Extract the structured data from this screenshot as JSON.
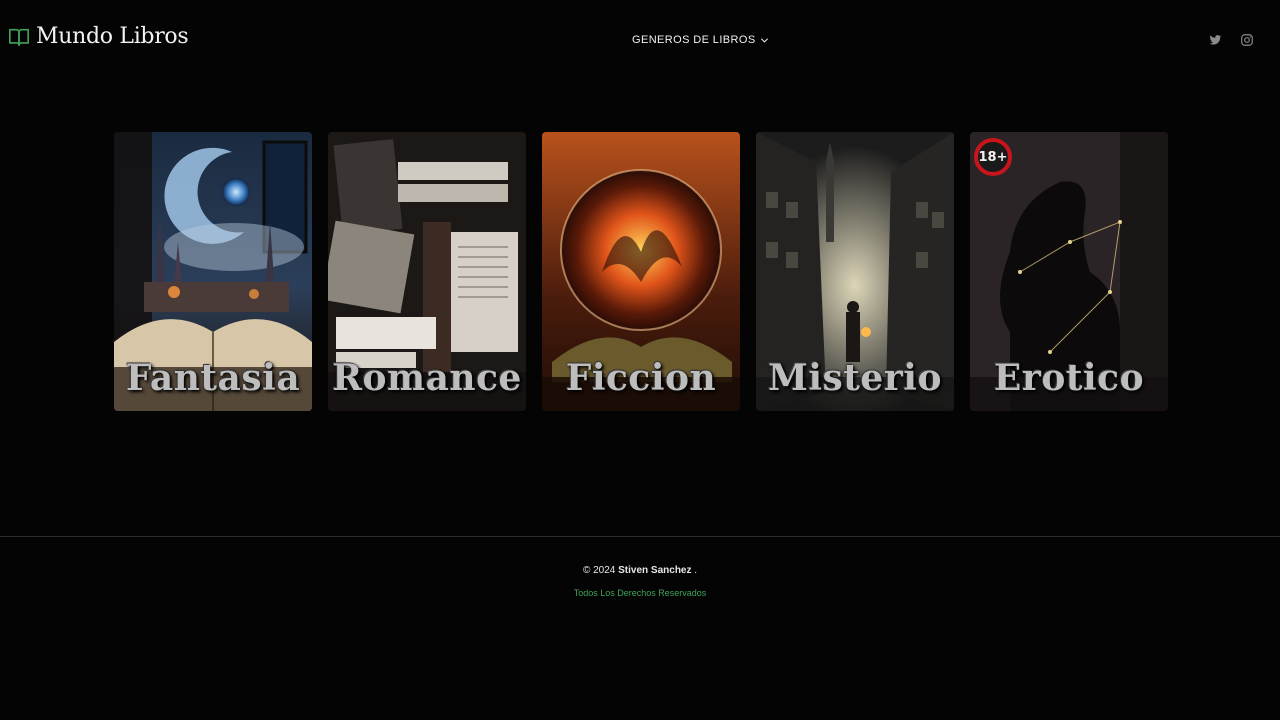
{
  "header": {
    "brand": "Mundo Libros",
    "nav_label": "GENEROS DE LIBROS",
    "socials": [
      "twitter-icon",
      "instagram-icon"
    ]
  },
  "genres": [
    {
      "label": "Fantasia"
    },
    {
      "label": "Romance"
    },
    {
      "label": "Ficcion"
    },
    {
      "label": "Misterio"
    },
    {
      "label": "Erotico",
      "badge": "18+"
    }
  ],
  "footer": {
    "copyright_prefix": "© 2024",
    "author": "Stiven Sanchez",
    "suffix": ".",
    "rights": "Todos Los Derechos Reservados"
  },
  "colors": {
    "background": "#040404",
    "accent_green": "#3fa35a"
  }
}
